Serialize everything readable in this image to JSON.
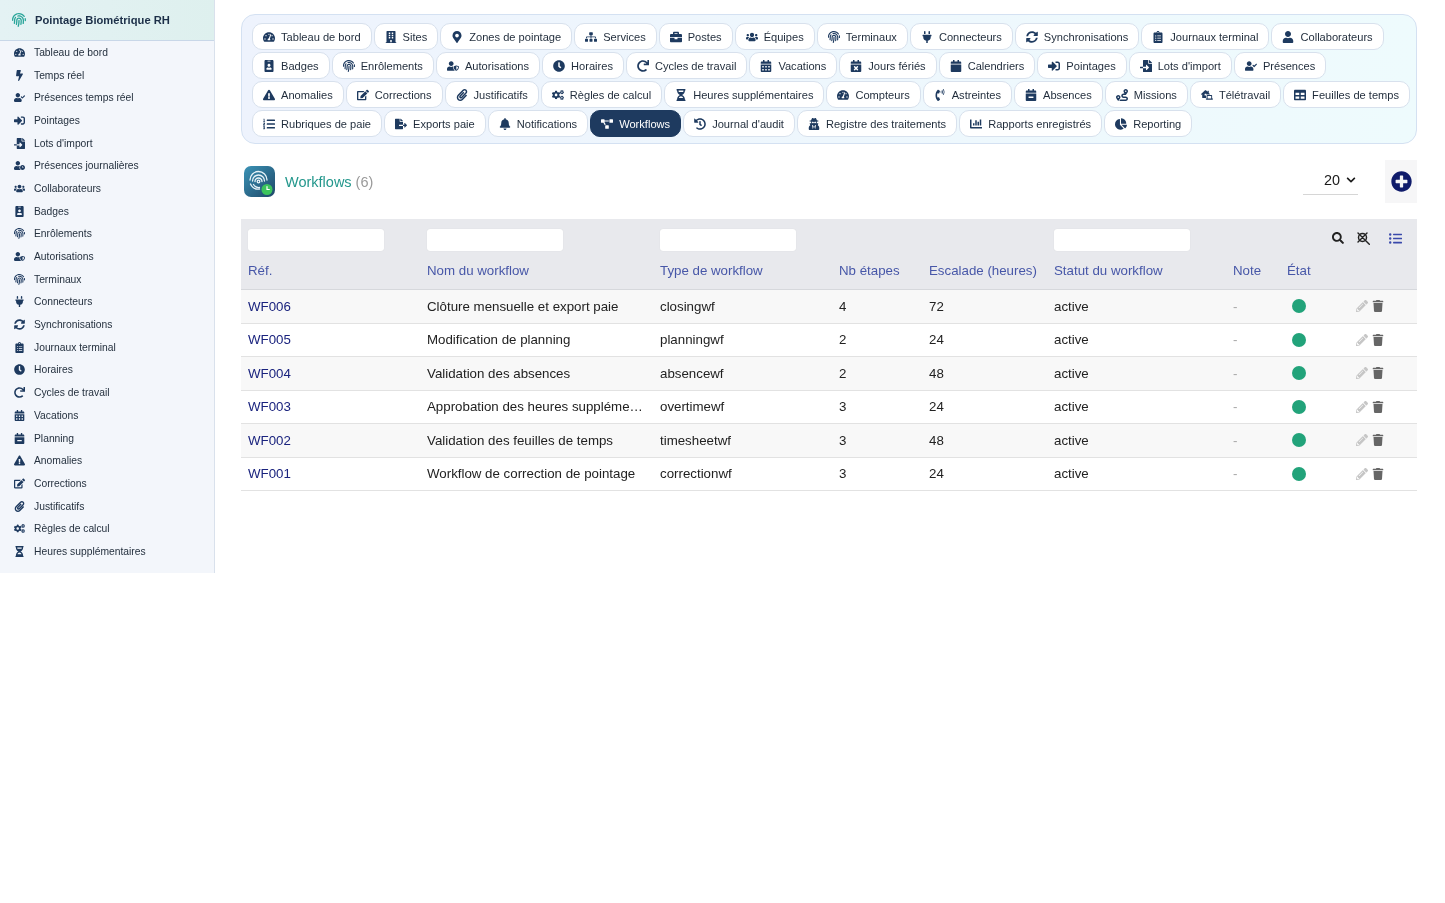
{
  "sidebar": {
    "title": "Pointage Biométrique RH",
    "items": [
      {
        "label": "Tableau de bord",
        "selected": false
      },
      {
        "label": "Temps réel",
        "selected": false
      },
      {
        "label": "Présences temps réel",
        "selected": false
      },
      {
        "label": "Pointages",
        "selected": false
      },
      {
        "label": "Lots d'import",
        "selected": false
      },
      {
        "label": "Présences journalières",
        "selected": false
      },
      {
        "label": "Collaborateurs",
        "selected": false
      },
      {
        "label": "Badges",
        "selected": false
      },
      {
        "label": "Enrôlements",
        "selected": false
      },
      {
        "label": "Autorisations",
        "selected": false
      },
      {
        "label": "Terminaux",
        "selected": false
      },
      {
        "label": "Connecteurs",
        "selected": false
      },
      {
        "label": "Synchronisations",
        "selected": false
      },
      {
        "label": "Journaux terminal",
        "selected": false
      },
      {
        "label": "Horaires",
        "selected": false
      },
      {
        "label": "Cycles de travail",
        "selected": false
      },
      {
        "label": "Vacations",
        "selected": false
      },
      {
        "label": "Planning",
        "selected": false
      },
      {
        "label": "Anomalies",
        "selected": false
      },
      {
        "label": "Corrections",
        "selected": false
      },
      {
        "label": "Justificatifs",
        "selected": false
      },
      {
        "label": "Règles de calcul",
        "selected": false
      },
      {
        "label": "Heures supplémentaires",
        "selected": false
      }
    ]
  },
  "tab_rows": [
    [
      {
        "label": "Tableau de bord",
        "selected": false
      },
      {
        "label": "Sites",
        "selected": false
      },
      {
        "label": "Zones de pointage",
        "selected": false
      },
      {
        "label": "Services",
        "selected": false
      },
      {
        "label": "Postes",
        "selected": false
      },
      {
        "label": "Équipes",
        "selected": false
      },
      {
        "label": "Terminaux",
        "selected": false
      },
      {
        "label": "Connecteurs",
        "selected": false
      },
      {
        "label": "Synchronisations",
        "selected": false
      },
      {
        "label": "Journaux terminal",
        "selected": false
      },
      {
        "label": "Collaborateurs",
        "selected": false
      }
    ],
    [
      {
        "label": "Badges",
        "selected": false
      },
      {
        "label": "Enrôlements",
        "selected": false
      },
      {
        "label": "Autorisations",
        "selected": false
      },
      {
        "label": "Horaires",
        "selected": false
      },
      {
        "label": "Cycles de travail",
        "selected": false
      },
      {
        "label": "Vacations",
        "selected": false
      },
      {
        "label": "Jours fériés",
        "selected": false
      },
      {
        "label": "Calendriers",
        "selected": false
      },
      {
        "label": "Pointages",
        "selected": false
      },
      {
        "label": "Lots d'import",
        "selected": false
      },
      {
        "label": "Présences",
        "selected": false
      }
    ],
    [
      {
        "label": "Anomalies",
        "selected": false
      },
      {
        "label": "Corrections",
        "selected": false
      },
      {
        "label": "Justificatifs",
        "selected": false
      },
      {
        "label": "Règles de calcul",
        "selected": false
      },
      {
        "label": "Heures supplémentaires",
        "selected": false
      },
      {
        "label": "Compteurs",
        "selected": false
      },
      {
        "label": "Astreintes",
        "selected": false
      },
      {
        "label": "Absences",
        "selected": false
      },
      {
        "label": "Missions",
        "selected": false
      },
      {
        "label": "Télétravail",
        "selected": false
      },
      {
        "label": "Feuilles de temps",
        "selected": false
      }
    ],
    [
      {
        "label": "Rubriques de paie",
        "selected": false
      },
      {
        "label": "Exports paie",
        "selected": false
      },
      {
        "label": "Notifications",
        "selected": false
      },
      {
        "label": "Workflows",
        "selected": true
      },
      {
        "label": "Journal d'audit",
        "selected": false
      },
      {
        "label": "Registre des traitements",
        "selected": false
      },
      {
        "label": "Rapports enregistrés",
        "selected": false
      },
      {
        "label": "Reporting",
        "selected": false
      }
    ]
  ],
  "page": {
    "title": "Workflows",
    "count": "(6)",
    "page_size": "20"
  },
  "table": {
    "columns": [
      {
        "label": "Réf.",
        "filterable": true
      },
      {
        "label": "Nom du workflow",
        "filterable": true
      },
      {
        "label": "Type de workflow",
        "filterable": true
      },
      {
        "label": "Nb étapes",
        "filterable": false
      },
      {
        "label": "Escalade (heures)",
        "filterable": false
      },
      {
        "label": "Statut du workflow",
        "filterable": true
      },
      {
        "label": "Note",
        "filterable": false
      },
      {
        "label": "État",
        "filterable": false
      }
    ],
    "rows": [
      {
        "ref": "WF006",
        "name": "Clôture mensuelle et export paie",
        "type": "closingwf",
        "steps": "4",
        "escalation": "72",
        "status": "active",
        "note": "-",
        "active": true
      },
      {
        "ref": "WF005",
        "name": "Modification de planning",
        "type": "planningwf",
        "steps": "2",
        "escalation": "24",
        "status": "active",
        "note": "-",
        "active": true
      },
      {
        "ref": "WF004",
        "name": "Validation des absences",
        "type": "absencewf",
        "steps": "2",
        "escalation": "48",
        "status": "active",
        "note": "-",
        "active": true
      },
      {
        "ref": "WF003",
        "name": "Approbation des heures suppléme…",
        "type": "overtimewf",
        "steps": "3",
        "escalation": "24",
        "status": "active",
        "note": "-",
        "active": true
      },
      {
        "ref": "WF002",
        "name": "Validation des feuilles de temps",
        "type": "timesheetwf",
        "steps": "3",
        "escalation": "48",
        "status": "active",
        "note": "-",
        "active": true
      },
      {
        "ref": "WF001",
        "name": "Workflow de correction de pointage",
        "type": "correctionwf",
        "steps": "3",
        "escalation": "24",
        "status": "active",
        "note": "-",
        "active": true
      }
    ]
  }
}
